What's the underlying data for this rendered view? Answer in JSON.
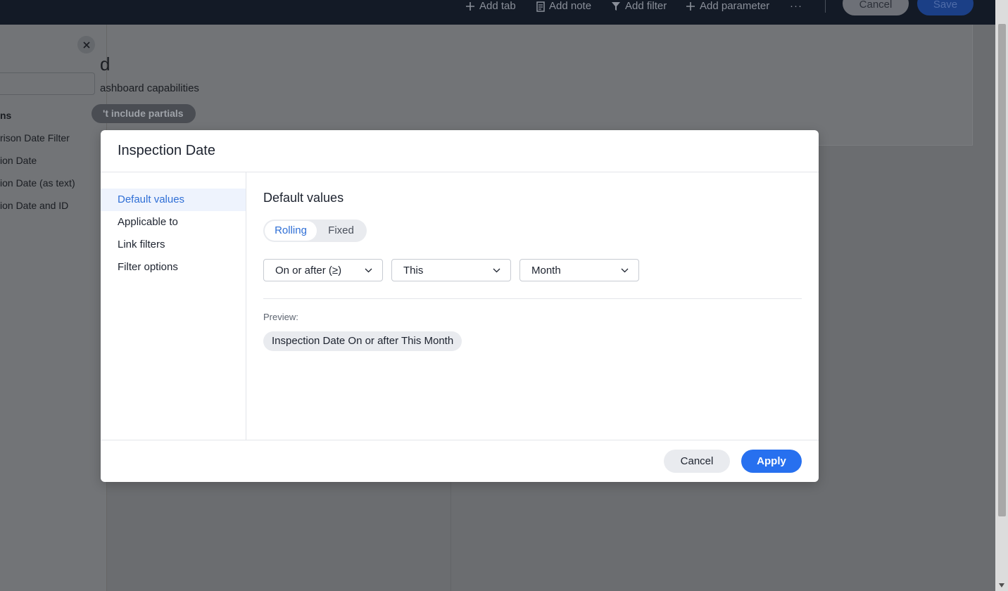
{
  "topbar": {
    "add_tab": "Add tab",
    "add_note": "Add note",
    "add_filter": "Add filter",
    "add_parameter": "Add parameter",
    "more": "···",
    "cancel": "Cancel",
    "save": "Save"
  },
  "background": {
    "sidebar_items": [
      "ns",
      "rison Date Filter",
      "ion Date",
      "ion Date (as text)",
      "ion Date and ID"
    ],
    "title_fragment": "d",
    "subtitle_fragment": "ashboard capabilities",
    "pill_fragment": "'t include partials"
  },
  "modal": {
    "title": "Inspection Date",
    "nav": [
      "Default values",
      "Applicable to",
      "Link filters",
      "Filter options"
    ],
    "section_title": "Default values",
    "toggle": {
      "rolling": "Rolling",
      "fixed": "Fixed",
      "selected": "Rolling"
    },
    "dropdowns": {
      "operator": "On or after (≥)",
      "period": "This",
      "unit": "Month"
    },
    "preview_label": "Preview:",
    "preview": {
      "field": "Inspection Date",
      "condition": "On or after This Month"
    },
    "cancel": "Cancel",
    "apply": "Apply"
  },
  "colors": {
    "accent": "#2770ef",
    "nav_active_bg": "#eef3fd",
    "topbar_bg": "#131a26"
  }
}
